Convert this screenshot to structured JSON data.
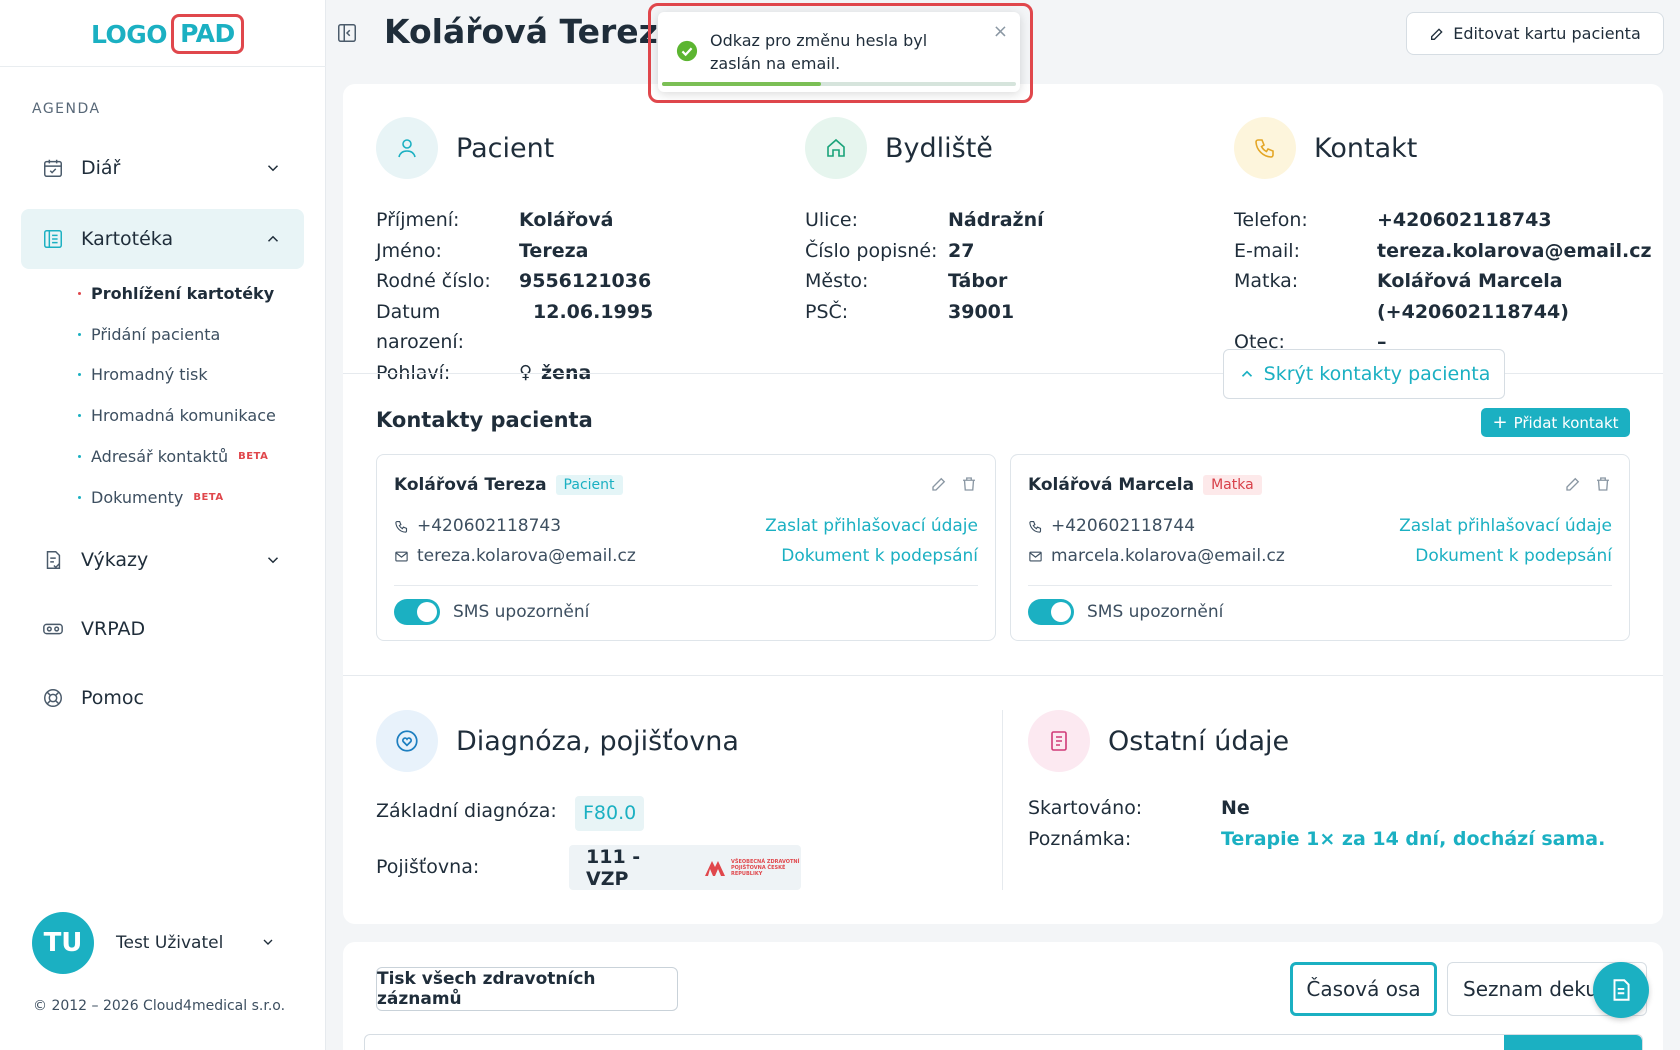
{
  "brand": {
    "logo_part1": "LOGO",
    "logo_part2": "PAD"
  },
  "sidebar": {
    "section_title": "AGENDA",
    "items": [
      {
        "label": "Diář"
      },
      {
        "label": "Kartotéka"
      },
      {
        "label": "Výkazy"
      },
      {
        "label": "VRPAD"
      },
      {
        "label": "Pomoc"
      }
    ],
    "sub_items": [
      {
        "label": "Prohlížení kartotéky"
      },
      {
        "label": "Přidání pacienta"
      },
      {
        "label": "Hromadný tisk"
      },
      {
        "label": "Hromadná komunikace"
      },
      {
        "label": "Adresář kontaktů",
        "badge": "BETA"
      },
      {
        "label": "Dokumenty",
        "badge": "BETA"
      }
    ],
    "user": {
      "initials": "TU",
      "name": "Test Uživatel"
    },
    "copyright": "© 2012 – 2026 Cloud4medical s.r.o."
  },
  "header": {
    "title": "Kolářová Tereza",
    "edit_button": "Editovat kartu pacienta"
  },
  "toast": {
    "message": "Odkaz pro změnu hesla byl zaslán na email.",
    "close": "×",
    "progress": 0.45
  },
  "patient": {
    "heading": "Pacient",
    "labels": {
      "surname": "Příjmení:",
      "name": "Jméno:",
      "birth_no": "Rodné číslo:",
      "dob": "Datum narození:",
      "sex": "Pohlaví:"
    },
    "values": {
      "surname": "Kolářová",
      "name": "Tereza",
      "birth_no": "9556121036",
      "dob": "12.06.1995",
      "sex": "žena"
    }
  },
  "address": {
    "heading": "Bydliště",
    "labels": {
      "street": "Ulice:",
      "number": "Číslo popisné:",
      "city": "Město:",
      "zip": "PSČ:"
    },
    "values": {
      "street": "Nádražní",
      "number": "27",
      "city": "Tábor",
      "zip": "39001"
    }
  },
  "contact": {
    "heading": "Kontakt",
    "labels": {
      "phone": "Telefon:",
      "email": "E-mail:",
      "mother": "Matka:",
      "father": "Otec:"
    },
    "values": {
      "phone": "+420602118743",
      "email": "tereza.kolarova@email.cz",
      "mother_name": "Kolářová Marcela",
      "mother_phone": "(+420602118744)",
      "father": "–"
    },
    "hide_button": "Skrýt kontakty pacienta"
  },
  "patient_contacts": {
    "heading": "Kontakty pacienta",
    "add_button": "Přidat kontakt",
    "cards": [
      {
        "name": "Kolářová Tereza",
        "tag": "Pacient",
        "phone": "+420602118743",
        "email": "tereza.kolarova@email.cz",
        "link1": "Zaslat přihlašovací údaje",
        "link2": "Dokument k podepsání",
        "toggle_label": "SMS upozornění"
      },
      {
        "name": "Kolářová Marcela",
        "tag": "Matka",
        "phone": "+420602118744",
        "email": "marcela.kolarova@email.cz",
        "link1": "Zaslat přihlašovací údaje",
        "link2": "Dokument k podepsání",
        "toggle_label": "SMS upozornění"
      }
    ]
  },
  "diagnosis": {
    "heading": "Diagnóza, pojišťovna",
    "diag_label": "Základní diagnóza:",
    "diag_value": "F80.0",
    "insurer_label": "Pojišťovna:",
    "insurer_value": "111 - VZP",
    "insurer_logo_text": "VŠEOBECNÁ ZDRAVOTNÍ POJIŠŤOVNA ČESKÉ REPUBLIKY"
  },
  "other": {
    "heading": "Ostatní údaje",
    "shred_label": "Skartováno:",
    "shred_value": "Ne",
    "note_label": "Poznámka:",
    "note_value": "Terapie 1× za 14 dní, dochází sama."
  },
  "bottom": {
    "print_button": "Tisk všech zdravotních záznamů",
    "timeline_button": "Časová osa",
    "list_button": "Seznam dekurzů"
  }
}
